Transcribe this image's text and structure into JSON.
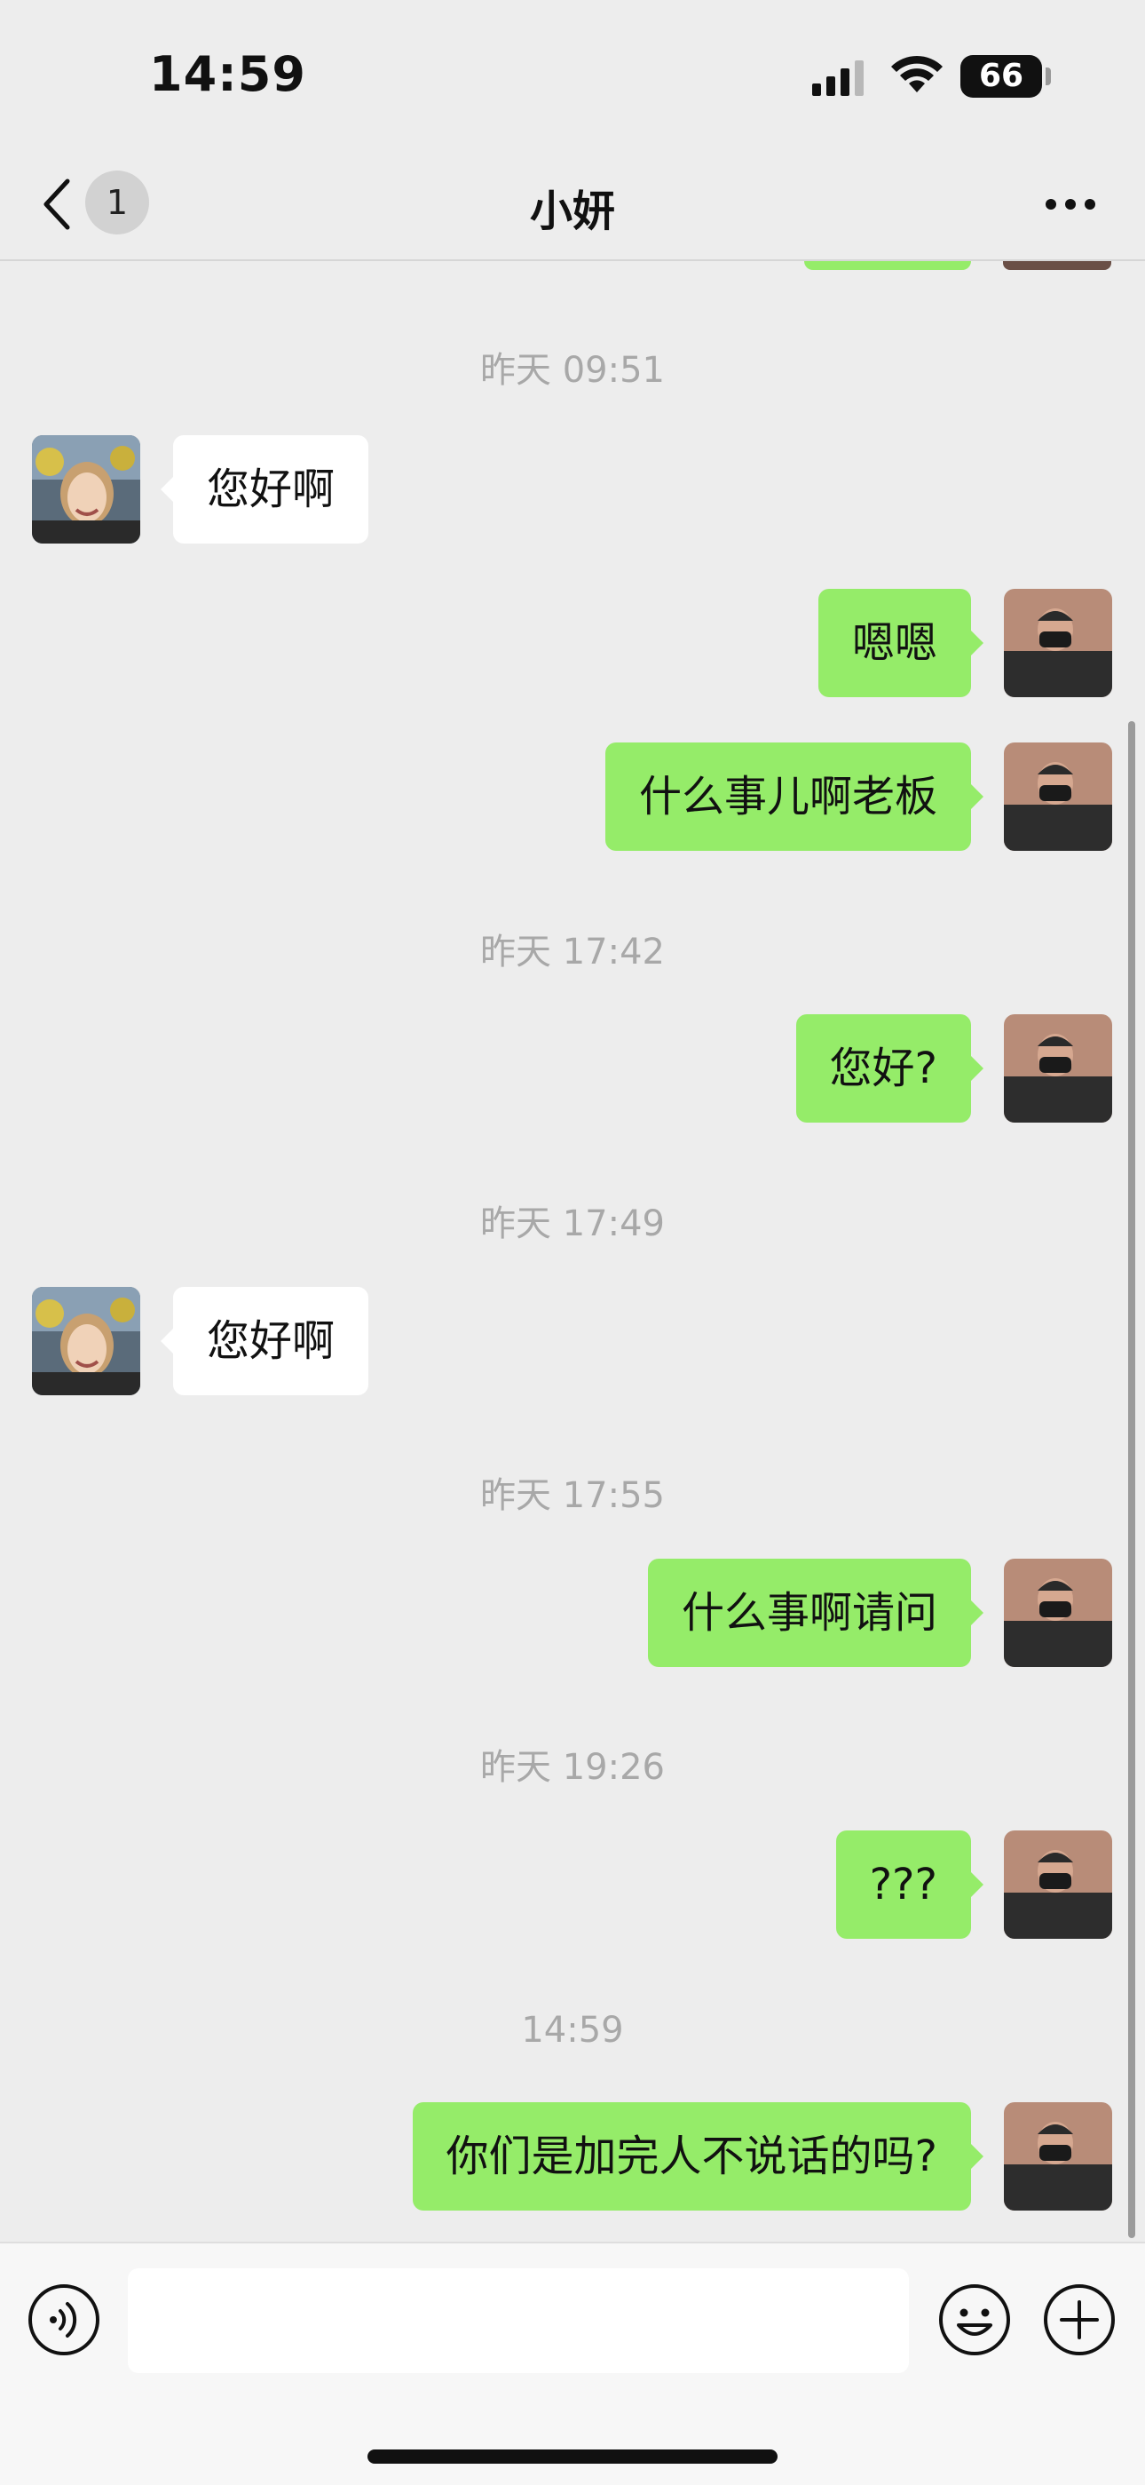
{
  "status_bar": {
    "time": "14:59",
    "battery": "66"
  },
  "nav": {
    "unread_count": "1",
    "title": "小妍"
  },
  "messages": [
    {
      "type": "timestamp",
      "text": "昨天 09:51"
    },
    {
      "type": "received",
      "text": "您好啊"
    },
    {
      "type": "sent",
      "text": "嗯嗯"
    },
    {
      "type": "sent",
      "text": "什么事儿啊老板"
    },
    {
      "type": "timestamp",
      "text": "昨天 17:42"
    },
    {
      "type": "sent",
      "text": "您好?"
    },
    {
      "type": "timestamp",
      "text": "昨天 17:49"
    },
    {
      "type": "received",
      "text": "您好啊"
    },
    {
      "type": "timestamp",
      "text": "昨天 17:55"
    },
    {
      "type": "sent",
      "text": "什么事啊请问"
    },
    {
      "type": "timestamp",
      "text": "昨天 19:26"
    },
    {
      "type": "sent",
      "text": "???"
    },
    {
      "type": "timestamp",
      "text": "14:59"
    },
    {
      "type": "sent",
      "text": "你们是加完人不说话的吗?"
    }
  ],
  "input": {
    "value": ""
  },
  "colors": {
    "sent_bubble": "#95ec69",
    "received_bubble": "#ffffff",
    "background": "#ededed"
  }
}
